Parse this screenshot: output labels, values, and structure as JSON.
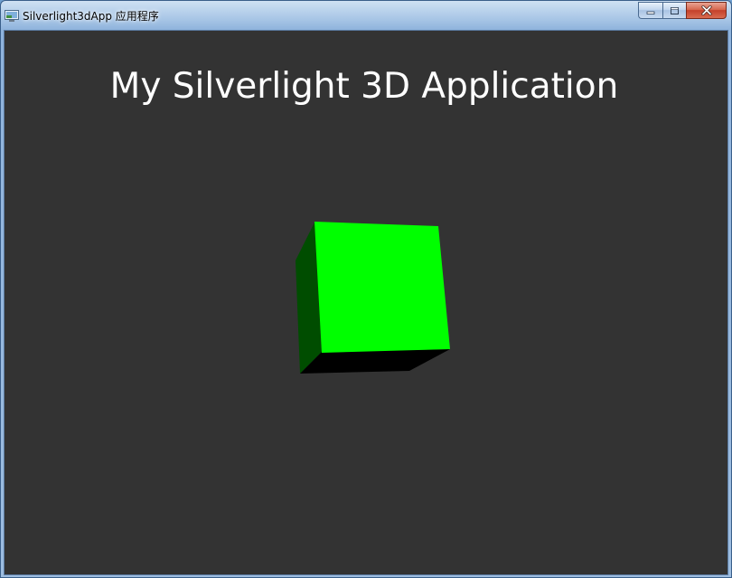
{
  "window": {
    "title": "Silverlight3dApp 应用程序",
    "icon": "silverlight-app-icon",
    "caption_buttons": {
      "minimize_icon": "minimize-icon",
      "maximize_icon": "maximize-icon",
      "close_icon": "close-x-icon"
    }
  },
  "app": {
    "heading": "My Silverlight 3D Application",
    "background_color": "#333333",
    "cube": {
      "front_color": "#00ff00",
      "side_color": "#004d00",
      "bottom_color": "#000000"
    }
  }
}
